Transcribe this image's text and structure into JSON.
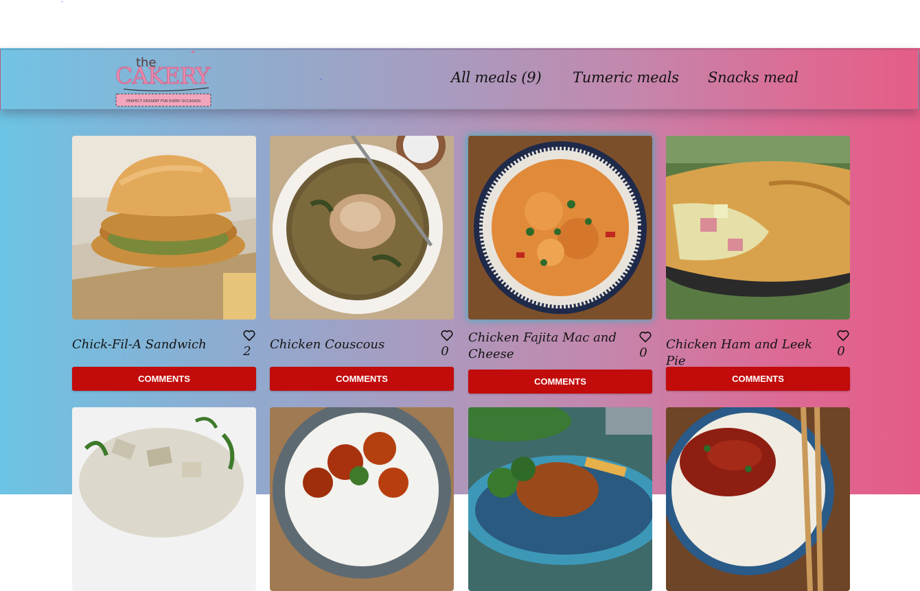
{
  "brand": {
    "logo_text_top": "the",
    "logo_text_main": "CAKERY",
    "logo_tagline": "PERFECT DESSERT FOR EVERY OCCASION"
  },
  "nav": {
    "all_meals": "All meals (9)",
    "tumeric_meals": "Tumeric meals",
    "snacks_meal": "Snacks meal"
  },
  "meals": [
    {
      "title": "Chick-Fil-A Sandwich",
      "likes": "2",
      "comments_label": "COMMENTS",
      "image": "chicken-sandwich"
    },
    {
      "title": "Chicken Couscous",
      "likes": "0",
      "comments_label": "COMMENTS",
      "image": "chicken-couscous"
    },
    {
      "title": "Chicken Fajita Mac and Cheese",
      "likes": "0",
      "comments_label": "COMMENTS",
      "image": "fajita-mac-and-cheese"
    },
    {
      "title": "Chicken Ham and Leek Pie",
      "likes": "0",
      "comments_label": "COMMENTS",
      "image": "ham-leek-pie"
    },
    {
      "title": "",
      "likes": "",
      "comments_label": "",
      "image": "chicken-salad"
    },
    {
      "title": "",
      "likes": "",
      "comments_label": "",
      "image": "glazed-chicken-rice"
    },
    {
      "title": "",
      "likes": "",
      "comments_label": "",
      "image": "chicken-broccoli-plate"
    },
    {
      "title": "",
      "likes": "",
      "comments_label": "",
      "image": "chicken-curry-rice"
    }
  ],
  "colors": {
    "button": "#c20b0b",
    "gradient_left": "#6cc4e4",
    "gradient_right": "#e45c86",
    "logo_pink": "#e8789a"
  }
}
